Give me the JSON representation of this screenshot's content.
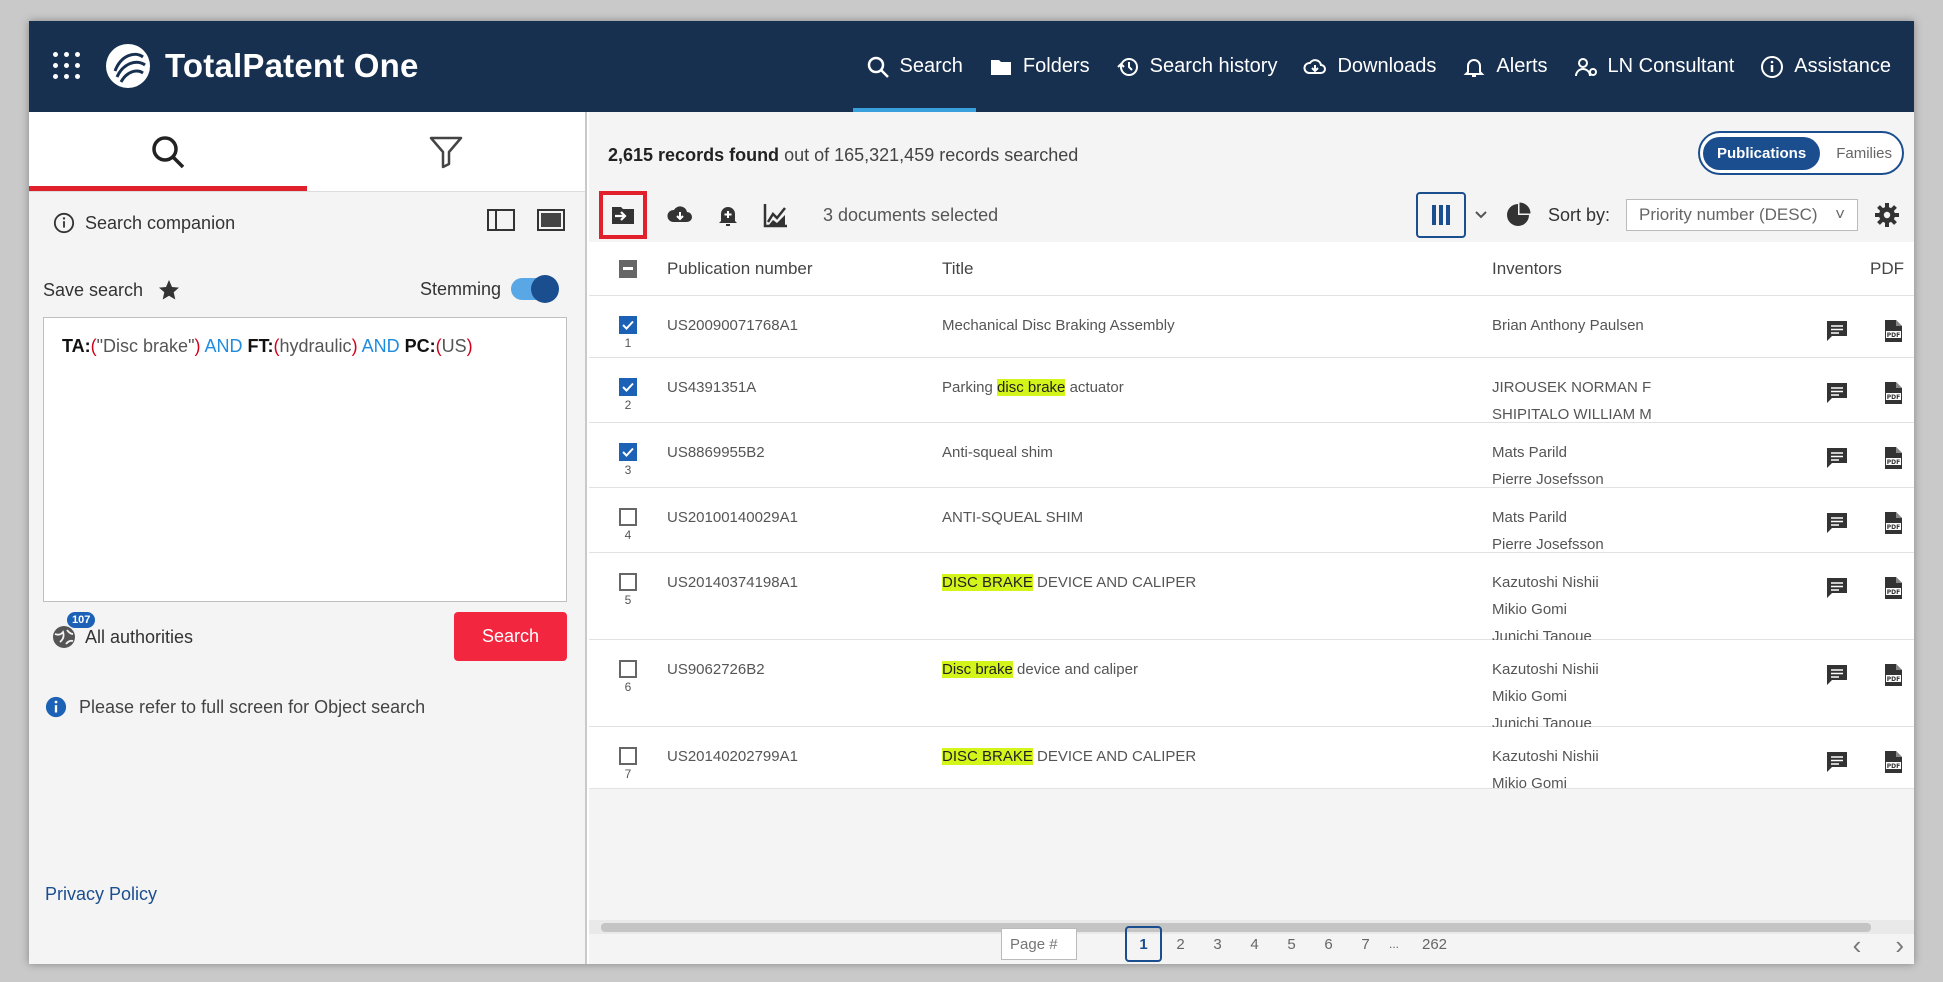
{
  "header": {
    "logo_text": "TotalPatent One",
    "nav": [
      {
        "label": "Search",
        "icon": "search-icon"
      },
      {
        "label": "Folders",
        "icon": "folder-icon"
      },
      {
        "label": "Search history",
        "icon": "history-icon"
      },
      {
        "label": "Downloads",
        "icon": "cloud-download-icon"
      },
      {
        "label": "Alerts",
        "icon": "bell-icon"
      },
      {
        "label": "LN Consultant",
        "icon": "consultant-icon"
      },
      {
        "label": "Assistance",
        "icon": "info-icon"
      }
    ]
  },
  "left": {
    "companion_label": "Search companion",
    "save_search_label": "Save search",
    "stemming_label": "Stemming",
    "stemming_on": true,
    "query": {
      "f1": "TA:",
      "t1": "\"Disc brake\"",
      "op1": "AND",
      "f2": "FT:",
      "t2": "hydraulic",
      "op2": "AND",
      "f3": "PC:",
      "t3": "US"
    },
    "authorities_badge": "107",
    "authorities_label": "All authorities",
    "search_button": "Search",
    "info_text": "Please refer to full screen for Object search",
    "privacy_link": "Privacy Policy"
  },
  "results": {
    "count_bold": "2,615 records found",
    "count_rest": "out of 165,321,459 records searched",
    "toggle_on": "Publications",
    "toggle_off": "Families",
    "selected_text": "3 documents selected",
    "sort_label": "Sort by:",
    "sort_value": "Priority number (DESC)",
    "columns": {
      "pub": "Publication number",
      "title": "Title",
      "inventors": "Inventors",
      "pdf": "PDF"
    },
    "rows": [
      {
        "num": "1",
        "checked": true,
        "pub": "US20090071768A1",
        "title_pre": "Mechanical Disc Braking Assembly",
        "title_hl": "",
        "title_post": "",
        "inventors": [
          "Brian Anthony Paulsen"
        ]
      },
      {
        "num": "2",
        "checked": true,
        "pub": "US4391351A",
        "title_pre": "Parking ",
        "title_hl": "disc brake",
        "title_post": " actuator",
        "inventors": [
          "JIROUSEK NORMAN F",
          "SHIPITALO WILLIAM M"
        ]
      },
      {
        "num": "3",
        "checked": true,
        "pub": "US8869955B2",
        "title_pre": "Anti-squeal shim",
        "title_hl": "",
        "title_post": "",
        "inventors": [
          "Mats Parild",
          "Pierre Josefsson"
        ]
      },
      {
        "num": "4",
        "checked": false,
        "pub": "US20100140029A1",
        "title_pre": "ANTI-SQUEAL SHIM",
        "title_hl": "",
        "title_post": "",
        "inventors": [
          "Mats Parild",
          "Pierre Josefsson"
        ]
      },
      {
        "num": "5",
        "checked": false,
        "pub": "US20140374198A1",
        "title_pre": "",
        "title_hl": "DISC BRAKE",
        "title_post": " DEVICE AND CALIPER",
        "inventors": [
          "Kazutoshi Nishii",
          "Mikio Gomi",
          "Junichi Tanoue"
        ]
      },
      {
        "num": "6",
        "checked": false,
        "pub": "US9062726B2",
        "title_pre": "",
        "title_hl": "Disc brake",
        "title_post": " device and caliper",
        "inventors": [
          "Kazutoshi Nishii",
          "Mikio Gomi",
          "Junichi Tanoue"
        ]
      },
      {
        "num": "7",
        "checked": false,
        "pub": "US20140202799A1",
        "title_pre": "",
        "title_hl": "DISC BRAKE",
        "title_post": " DEVICE AND CALIPER",
        "inventors": [
          "Kazutoshi Nishii",
          "Mikio Gomi"
        ]
      }
    ],
    "pager": {
      "placeholder": "Page #",
      "pages": [
        "1",
        "2",
        "3",
        "4",
        "5",
        "6",
        "7"
      ],
      "dots": "...",
      "last": "262",
      "current": "1",
      "prev": "‹",
      "next": "›"
    }
  },
  "colors": {
    "header_bg": "#17304f",
    "accent_red": "#e2202c",
    "brand_blue": "#1b4e8f",
    "highlight": "#d4f51a"
  }
}
